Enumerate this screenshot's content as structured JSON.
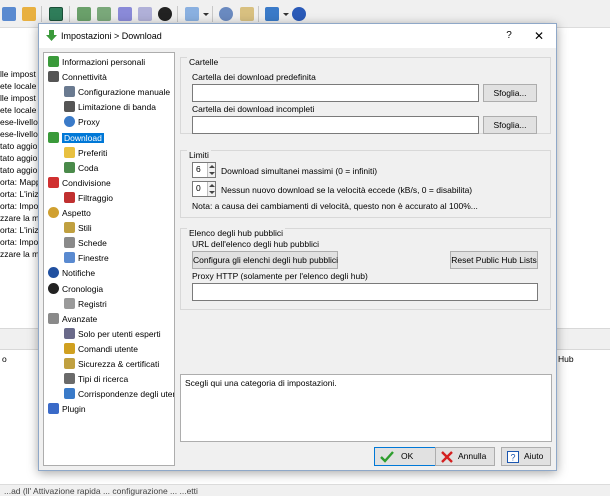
{
  "background_app": {
    "log_lines": [
      "lle impost",
      "ete locale",
      "lle impost",
      "ete locale",
      "ese-livello",
      "ese-livello",
      "tato aggio",
      "tato aggio",
      "tato aggio",
      "orta: Mapp",
      "orta: L'iniz",
      "orta: Impo",
      "zzare la m",
      "orta: L'iniz",
      "orta: Impo",
      "zzare la m"
    ],
    "lower_left_text": "o",
    "lower_right_text": "Hub",
    "status_text": "...ad (ll' Attivazione rapida ... configurazione ... ...etti"
  },
  "dialog": {
    "title": "Impostazioni > Download",
    "help_label": "?",
    "close_label": "✕",
    "tree": [
      {
        "label": "Informazioni personali",
        "icon": "user-icon"
      },
      {
        "label": "Connettività",
        "icon": "antenna-icon"
      },
      {
        "label": "Configurazione manuale",
        "icon": "gear-icon"
      },
      {
        "label": "Limitazione di banda",
        "icon": "speedometer-icon"
      },
      {
        "label": "Proxy",
        "icon": "globe-icon"
      },
      {
        "label": "Download",
        "icon": "download-arrow-icon"
      },
      {
        "label": "Preferiti",
        "icon": "folder-icon"
      },
      {
        "label": "Coda",
        "icon": "queue-icon"
      },
      {
        "label": "Condivisione",
        "icon": "upload-arrow-icon"
      },
      {
        "label": "Filtraggio",
        "icon": "filter-icon"
      },
      {
        "label": "Aspetto",
        "icon": "palette-icon"
      },
      {
        "label": "Stili",
        "icon": "brush-icon"
      },
      {
        "label": "Schede",
        "icon": "tabs-icon"
      },
      {
        "label": "Finestre",
        "icon": "window-icon"
      },
      {
        "label": "Notifiche",
        "icon": "bell-icon"
      },
      {
        "label": "Cronologia",
        "icon": "clock-icon"
      },
      {
        "label": "Registri",
        "icon": "log-icon"
      },
      {
        "label": "Avanzate",
        "icon": "advanced-gear-icon"
      },
      {
        "label": "Solo per utenti esperti",
        "icon": "tools-icon"
      },
      {
        "label": "Comandi utente",
        "icon": "key-icon"
      },
      {
        "label": "Sicurezza & certificati",
        "icon": "certificate-icon"
      },
      {
        "label": "Tipi di ricerca",
        "icon": "search-icon"
      },
      {
        "label": "Corrispondenze degli utenti",
        "icon": "users-match-icon"
      },
      {
        "label": "Plugin",
        "icon": "plugin-icon"
      }
    ],
    "cartelle": {
      "title": "Cartelle",
      "default_label": "Cartella dei download predefinita",
      "default_value": "",
      "incomplete_label": "Cartella dei download incompleti",
      "incomplete_value": "",
      "browse_label": "Sfoglia..."
    },
    "limiti": {
      "title": "Limiti",
      "max_downloads_value": "6",
      "max_downloads_label": "Download simultanei massimi (0 = infiniti)",
      "speed_value": "0",
      "speed_label": "Nessun nuovo download se la velocità eccede (kB/s, 0 = disabilita)",
      "note": "Nota: a causa dei cambiamenti di velocità, questo non è accurato al 100%..."
    },
    "hub_lists": {
      "title": "Elenco degli hub pubblici",
      "url_label": "URL dell'elenco degli hub pubblici",
      "configure_label": "Configura gli elenchi degli hub pubblici",
      "reset_label": "Reset Public Hub Lists",
      "proxy_label": "Proxy HTTP (solamente per l'elenco degli hub)",
      "proxy_value": ""
    },
    "description": "Scegli qui una categoria di impostazioni.",
    "buttons": {
      "ok": "OK",
      "cancel": "Annulla",
      "help": "Aiuto"
    },
    "colors": {
      "selection": "#0078d7",
      "ok_check": "#2e9e2e",
      "cancel_x": "#d42020",
      "help_blue": "#1a56b0"
    }
  }
}
